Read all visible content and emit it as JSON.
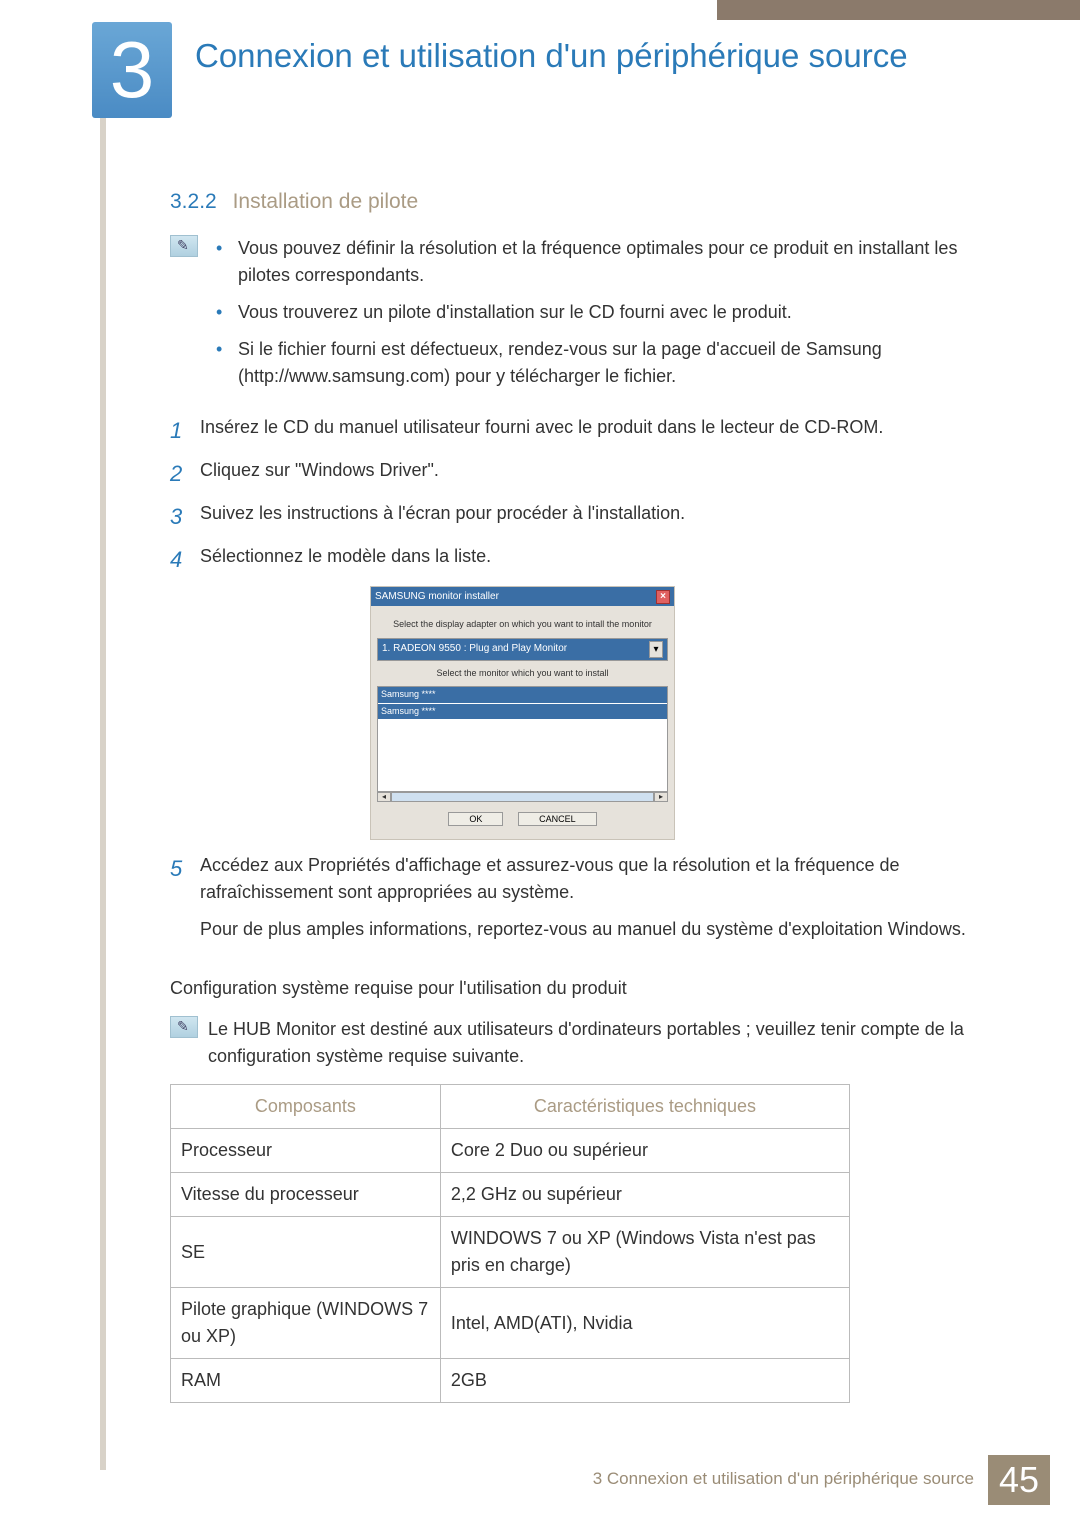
{
  "chapter": {
    "number": "3",
    "title": "Connexion et utilisation d'un périphérique source"
  },
  "section": {
    "number": "3.2.2",
    "title": "Installation de pilote"
  },
  "note1": {
    "items": [
      "Vous pouvez définir la résolution et la fréquence optimales pour ce produit en installant les pilotes correspondants.",
      "Vous trouverez un pilote d'installation sur le CD fourni avec le produit.",
      "Si le fichier fourni est défectueux, rendez-vous sur la page d'accueil de Samsung (http://www.samsung.com) pour y télécharger le fichier."
    ]
  },
  "steps": [
    "Insérez le CD du manuel utilisateur fourni avec le produit dans le lecteur de CD-ROM.",
    "Cliquez sur \"Windows Driver\".",
    "Suivez les instructions à l'écran pour procéder à l'installation.",
    "Sélectionnez le modèle dans la liste."
  ],
  "installer": {
    "title": "SAMSUNG monitor installer",
    "label1": "Select the display adapter on which you want to intall the monitor",
    "select": "1. RADEON 9550 : Plug and Play Monitor",
    "label2": "Select the monitor which you want to install",
    "list": [
      "Samsung ****",
      "Samsung ****"
    ],
    "ok": "OK",
    "cancel": "CANCEL"
  },
  "step5": {
    "num": "5",
    "text": "Accédez aux Propriétés d'affichage et assurez-vous que la résolution et la fréquence de rafraîchissement sont appropriées au système.",
    "text2": "Pour de plus amples informations, reportez-vous au manuel du système d'exploitation Windows."
  },
  "sysreq_head": "Configuration système requise pour l'utilisation du produit",
  "note2": "Le HUB Monitor est destiné aux utilisateurs d'ordinateurs portables ; veuillez tenir compte de la configuration système requise suivante.",
  "table": {
    "h1": "Composants",
    "h2": "Caractéristiques techniques",
    "rows": [
      {
        "c": "Processeur",
        "v": "Core 2 Duo ou supérieur"
      },
      {
        "c": "Vitesse du processeur",
        "v": "2,2 GHz ou supérieur"
      },
      {
        "c": "SE",
        "v": "WINDOWS 7 ou XP (Windows Vista n'est pas pris en charge)"
      },
      {
        "c": "Pilote graphique (WINDOWS 7 ou XP)",
        "v": "Intel, AMD(ATI), Nvidia"
      },
      {
        "c": "RAM",
        "v": "2GB"
      }
    ]
  },
  "footer": {
    "text": "3 Connexion et utilisation d'un périphérique source",
    "page": "45"
  }
}
